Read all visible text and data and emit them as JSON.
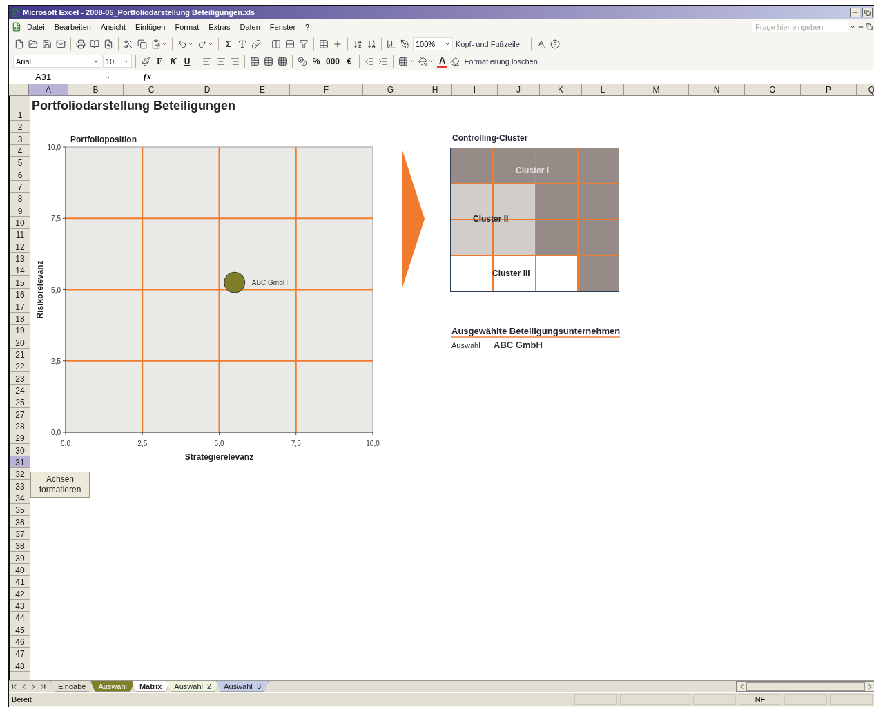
{
  "window": {
    "title": "Microsoft Excel - 2008-05_Portfoliodarstellung Beteiligungen.xls"
  },
  "menu": [
    "Datei",
    "Bearbeiten",
    "Ansicht",
    "Einfügen",
    "Format",
    "Extras",
    "Daten",
    "Fenster",
    "?"
  ],
  "help_field": {
    "placeholder": "Frage hier eingeben"
  },
  "standard_toolbar": {
    "sum": "Σ",
    "zoom": "100%",
    "header_footer": "Kopf- und Fußzeile..."
  },
  "format_toolbar": {
    "font": "Arial",
    "size": "10",
    "bold": "F",
    "italic": "K",
    "underline": "U",
    "percent": "%",
    "thousands": "000",
    "euro": "€",
    "font_color": "A",
    "clear_format": "Formatierung löschen"
  },
  "formula_bar": {
    "name_box": "A31",
    "fx": "ƒx"
  },
  "columns": [
    {
      "label": "A",
      "selected": true
    },
    {
      "label": "B",
      "selected": false
    },
    {
      "label": "C",
      "selected": false
    },
    {
      "label": "D",
      "selected": false
    },
    {
      "label": "E",
      "selected": false
    },
    {
      "label": "F",
      "selected": false
    },
    {
      "label": "G",
      "selected": false
    },
    {
      "label": "H",
      "selected": false
    },
    {
      "label": "I",
      "selected": false
    },
    {
      "label": "J",
      "selected": false
    },
    {
      "label": "K",
      "selected": false
    },
    {
      "label": "L",
      "selected": false
    },
    {
      "label": "M",
      "selected": false
    },
    {
      "label": "N",
      "selected": false
    },
    {
      "label": "O",
      "selected": false
    },
    {
      "label": "P",
      "selected": false
    },
    {
      "label": "Q",
      "selected": false
    }
  ],
  "rows": [
    {
      "label": "1",
      "selected": false
    },
    {
      "label": "2",
      "selected": false
    },
    {
      "label": "3",
      "selected": false
    },
    {
      "label": "4",
      "selected": false
    },
    {
      "label": "5",
      "selected": false
    },
    {
      "label": "6",
      "selected": false
    },
    {
      "label": "7",
      "selected": false
    },
    {
      "label": "8",
      "selected": false
    },
    {
      "label": "9",
      "selected": false
    },
    {
      "label": "10",
      "selected": false
    },
    {
      "label": "11",
      "selected": false
    },
    {
      "label": "12",
      "selected": false
    },
    {
      "label": "13",
      "selected": false
    },
    {
      "label": "14",
      "selected": false
    },
    {
      "label": "15",
      "selected": false
    },
    {
      "label": "16",
      "selected": false
    },
    {
      "label": "17",
      "selected": false
    },
    {
      "label": "18",
      "selected": false
    },
    {
      "label": "19",
      "selected": false
    },
    {
      "label": "20",
      "selected": false
    },
    {
      "label": "21",
      "selected": false
    },
    {
      "label": "22",
      "selected": false
    },
    {
      "label": "23",
      "selected": false
    },
    {
      "label": "24",
      "selected": false
    },
    {
      "label": "25",
      "selected": false
    },
    {
      "label": "27",
      "selected": false
    },
    {
      "label": "28",
      "selected": false
    },
    {
      "label": "29",
      "selected": false
    },
    {
      "label": "30",
      "selected": false
    },
    {
      "label": "31",
      "selected": true
    },
    {
      "label": "32",
      "selected": false
    },
    {
      "label": "33",
      "selected": false
    },
    {
      "label": "34",
      "selected": false
    },
    {
      "label": "35",
      "selected": false
    },
    {
      "label": "36",
      "selected": false
    },
    {
      "label": "37",
      "selected": false
    },
    {
      "label": "38",
      "selected": false
    },
    {
      "label": "39",
      "selected": false
    },
    {
      "label": "40",
      "selected": false
    },
    {
      "label": "41",
      "selected": false
    },
    {
      "label": "42",
      "selected": false
    },
    {
      "label": "43",
      "selected": false
    },
    {
      "label": "44",
      "selected": false
    },
    {
      "label": "45",
      "selected": false
    },
    {
      "label": "46",
      "selected": false
    },
    {
      "label": "47",
      "selected": false
    },
    {
      "label": "48",
      "selected": false
    }
  ],
  "sheet": {
    "title": "Portfoliodarstellung Beteiligungen",
    "chart": {
      "chart_data": {
        "type": "scatter",
        "title": "Portfolioposition",
        "xlabel": "Strategierelevanz",
        "ylabel": "Risikorelevanz",
        "xlim": [
          0,
          10
        ],
        "ylim": [
          0,
          10
        ],
        "xticks": [
          {
            "value": 0,
            "label": "0,0"
          },
          {
            "value": 2.5,
            "label": "2,5"
          },
          {
            "value": 5,
            "label": "5,0"
          },
          {
            "value": 7.5,
            "label": "7,5"
          },
          {
            "value": 10,
            "label": "10,0"
          }
        ],
        "yticks": [
          {
            "value": 0,
            "label": "0,0"
          },
          {
            "value": 2.5,
            "label": "2,5"
          },
          {
            "value": 5,
            "label": "5,0"
          },
          {
            "value": 7.5,
            "label": "7,5"
          },
          {
            "value": 10,
            "label": "10,0"
          }
        ],
        "x": [
          5.5
        ],
        "series": [
          {
            "name": "ABC GmbH",
            "color": "#7f7f2a",
            "values": [
              5.25
            ]
          }
        ],
        "grid": true
      }
    },
    "cluster": {
      "title": "Controlling-Cluster",
      "cells": [
        [
          {
            "color": "#968b87"
          },
          {
            "color": "#968b87"
          },
          {
            "color": "#968b87"
          },
          {
            "color": "#968b87"
          }
        ],
        [
          {
            "color": "#d2cdc9"
          },
          {
            "color": "#d2cdc9"
          },
          {
            "color": "#968b87"
          },
          {
            "color": "#968b87"
          }
        ],
        [
          {
            "color": "#d2cdc9"
          },
          {
            "color": "#d2cdc9"
          },
          {
            "color": "#968b87"
          },
          {
            "color": "#968b87"
          }
        ],
        [
          {
            "color": "#ffffff"
          },
          {
            "color": "#ffffff"
          },
          {
            "color": "#ffffff"
          },
          {
            "color": "#968b87"
          }
        ]
      ],
      "labels": [
        "Cluster I",
        "Cluster II",
        "Cluster III"
      ]
    },
    "selection": {
      "heading": "Ausgewählte Beteiligungsunternehmen",
      "label": "Auswahl",
      "value": "ABC GmbH"
    },
    "button": "Achsen\nformatieren"
  },
  "sheet_tabs": [
    {
      "label": "Eingabe",
      "selected": false
    },
    {
      "label": "Auswahl",
      "selected": false,
      "color": "#7f7f2a"
    },
    {
      "label": "Matrix",
      "selected": true
    },
    {
      "label": "Auswahl_2",
      "selected": false,
      "color": "#eef5dc"
    },
    {
      "label": "Auswahl_3",
      "selected": false,
      "color": "#c3cde8"
    }
  ],
  "status_bar": {
    "status": "Bereit",
    "indicator": "NF"
  }
}
